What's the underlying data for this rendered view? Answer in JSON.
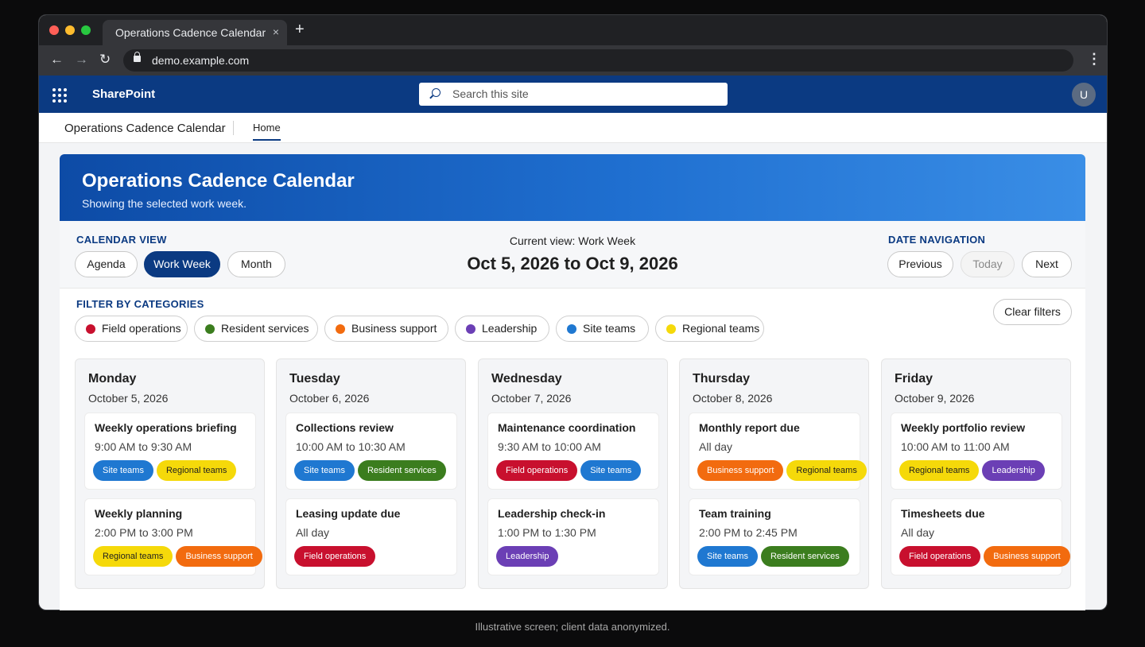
{
  "browser": {
    "tab_title": "Operations Cadence Calendar",
    "tab_close": "×",
    "new_tab": "+",
    "url": "demo.example.com"
  },
  "suite": {
    "brand": "SharePoint",
    "search_placeholder": "Search this site",
    "avatar_initial": "U"
  },
  "sitenav": {
    "site_title": "Operations Cadence Calendar",
    "home": "Home"
  },
  "hero": {
    "title": "Operations Cadence Calendar",
    "subtitle": "Showing the selected work week."
  },
  "controls": {
    "calendar_view_label": "CALENDAR VIEW",
    "views": [
      "Agenda",
      "Work Week",
      "Month"
    ],
    "active_view": "Work Week",
    "current_view_text": "Current view: Work Week",
    "date_range": "Oct 5, 2026 to Oct 9, 2026",
    "date_nav_label": "DATE NAVIGATION",
    "previous": "Previous",
    "today": "Today",
    "next": "Next"
  },
  "filters": {
    "label": "FILTER BY CATEGORIES",
    "clear": "Clear filters",
    "categories": [
      {
        "name": "Field operations",
        "color": "#c8102e"
      },
      {
        "name": "Resident services",
        "color": "#3b7d1e"
      },
      {
        "name": "Business support",
        "color": "#f26b0f"
      },
      {
        "name": "Leadership",
        "color": "#6b3fb5"
      },
      {
        "name": "Site teams",
        "color": "#1f78d1"
      },
      {
        "name": "Regional teams",
        "color": "#f5d90a"
      }
    ]
  },
  "days": [
    {
      "name": "Monday",
      "date": "October 5, 2026",
      "events": [
        {
          "title": "Weekly operations briefing",
          "time": "9:00 AM to 9:30 AM",
          "tags": [
            "Site teams",
            "Regional teams"
          ]
        },
        {
          "title": "Weekly planning",
          "time": "2:00 PM to 3:00 PM",
          "tags": [
            "Regional teams",
            "Business support"
          ]
        }
      ]
    },
    {
      "name": "Tuesday",
      "date": "October 6, 2026",
      "events": [
        {
          "title": "Collections review",
          "time": "10:00 AM to 10:30 AM",
          "tags": [
            "Site teams",
            "Resident services"
          ]
        },
        {
          "title": "Leasing update due",
          "time": "All day",
          "tags": [
            "Field operations"
          ]
        }
      ]
    },
    {
      "name": "Wednesday",
      "date": "October 7, 2026",
      "events": [
        {
          "title": "Maintenance coordination",
          "time": "9:30 AM to 10:00 AM",
          "tags": [
            "Field operations",
            "Site teams"
          ]
        },
        {
          "title": "Leadership check-in",
          "time": "1:00 PM to 1:30 PM",
          "tags": [
            "Leadership"
          ]
        }
      ]
    },
    {
      "name": "Thursday",
      "date": "October 8, 2026",
      "events": [
        {
          "title": "Monthly report due",
          "time": "All day",
          "tags": [
            "Business support",
            "Regional teams"
          ]
        },
        {
          "title": "Team training",
          "time": "2:00 PM to 2:45 PM",
          "tags": [
            "Site teams",
            "Resident services"
          ]
        }
      ]
    },
    {
      "name": "Friday",
      "date": "October 9, 2026",
      "events": [
        {
          "title": "Weekly portfolio review",
          "time": "10:00 AM to 11:00 AM",
          "tags": [
            "Regional teams",
            "Leadership"
          ]
        },
        {
          "title": "Timesheets due",
          "time": "All day",
          "tags": [
            "Field operations",
            "Business support"
          ]
        }
      ]
    }
  ],
  "caption": "Illustrative screen; client data anonymized."
}
